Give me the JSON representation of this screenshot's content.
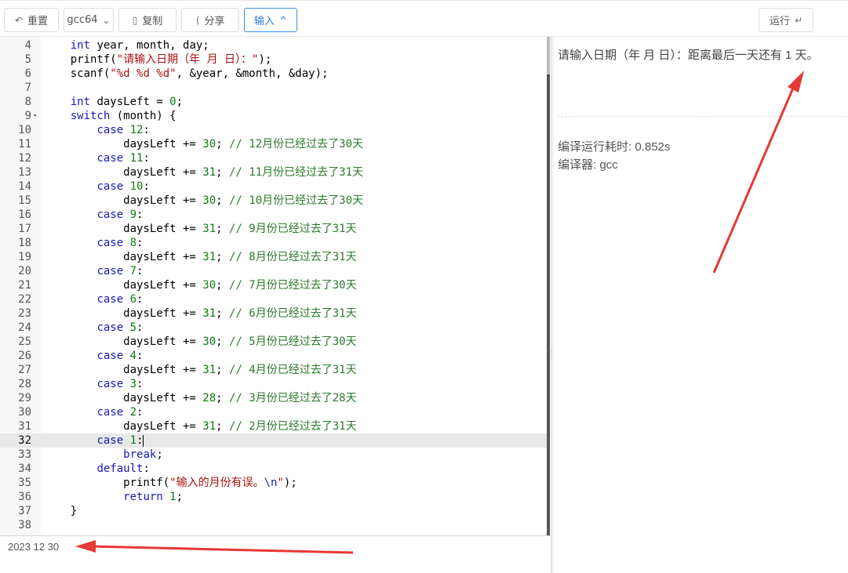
{
  "toolbar": {
    "reset_icon": "undo-icon",
    "reset_label": "重置",
    "compiler_label": "gcc64",
    "compiler_arrow": "⌄",
    "copy_icon": "copy-icon",
    "copy_label": "复制",
    "share_icon": "share-icon",
    "share_label": "分享",
    "input_label": "输入",
    "input_arrow": "^",
    "run_label": "运行",
    "run_icon": "↵"
  },
  "editor": {
    "active_line": 32,
    "lines": [
      {
        "n": "4",
        "tokens": [
          [
            "",
            "    "
          ],
          [
            "kw",
            "int"
          ],
          [
            "",
            " year, month, day;"
          ]
        ]
      },
      {
        "n": "5",
        "tokens": [
          [
            "",
            "    printf("
          ],
          [
            "str",
            "\"请输入日期（年 月 日）：\""
          ],
          [
            "",
            ");"
          ]
        ]
      },
      {
        "n": "6",
        "tokens": [
          [
            "",
            "    scanf("
          ],
          [
            "str",
            "\"%d %d %d\""
          ],
          [
            "",
            ", &year, &month, &day);"
          ]
        ]
      },
      {
        "n": "7",
        "tokens": []
      },
      {
        "n": "8",
        "tokens": [
          [
            "",
            "    "
          ],
          [
            "kw",
            "int"
          ],
          [
            "",
            " daysLeft = "
          ],
          [
            "num",
            "0"
          ],
          [
            "",
            ";"
          ]
        ]
      },
      {
        "n": "9",
        "fold": true,
        "tokens": [
          [
            "",
            "    "
          ],
          [
            "kw",
            "switch"
          ],
          [
            "",
            " (month) {"
          ]
        ]
      },
      {
        "n": "10",
        "tokens": [
          [
            "",
            "        "
          ],
          [
            "kw",
            "case"
          ],
          [
            "",
            " "
          ],
          [
            "num",
            "12"
          ],
          [
            "",
            ":"
          ]
        ]
      },
      {
        "n": "11",
        "tokens": [
          [
            "",
            "            daysLeft += "
          ],
          [
            "num",
            "30"
          ],
          [
            "",
            "; "
          ],
          [
            "cmt",
            "// 12月份已经过去了30天"
          ]
        ]
      },
      {
        "n": "12",
        "tokens": [
          [
            "",
            "        "
          ],
          [
            "kw",
            "case"
          ],
          [
            "",
            " "
          ],
          [
            "num",
            "11"
          ],
          [
            "",
            ":"
          ]
        ]
      },
      {
        "n": "13",
        "tokens": [
          [
            "",
            "            daysLeft += "
          ],
          [
            "num",
            "31"
          ],
          [
            "",
            "; "
          ],
          [
            "cmt",
            "// 11月份已经过去了31天"
          ]
        ]
      },
      {
        "n": "14",
        "tokens": [
          [
            "",
            "        "
          ],
          [
            "kw",
            "case"
          ],
          [
            "",
            " "
          ],
          [
            "num",
            "10"
          ],
          [
            "",
            ":"
          ]
        ]
      },
      {
        "n": "15",
        "tokens": [
          [
            "",
            "            daysLeft += "
          ],
          [
            "num",
            "30"
          ],
          [
            "",
            "; "
          ],
          [
            "cmt",
            "// 10月份已经过去了30天"
          ]
        ]
      },
      {
        "n": "16",
        "tokens": [
          [
            "",
            "        "
          ],
          [
            "kw",
            "case"
          ],
          [
            "",
            " "
          ],
          [
            "num",
            "9"
          ],
          [
            "",
            ":"
          ]
        ]
      },
      {
        "n": "17",
        "tokens": [
          [
            "",
            "            daysLeft += "
          ],
          [
            "num",
            "31"
          ],
          [
            "",
            "; "
          ],
          [
            "cmt",
            "// 9月份已经过去了31天"
          ]
        ]
      },
      {
        "n": "18",
        "tokens": [
          [
            "",
            "        "
          ],
          [
            "kw",
            "case"
          ],
          [
            "",
            " "
          ],
          [
            "num",
            "8"
          ],
          [
            "",
            ":"
          ]
        ]
      },
      {
        "n": "19",
        "tokens": [
          [
            "",
            "            daysLeft += "
          ],
          [
            "num",
            "31"
          ],
          [
            "",
            "; "
          ],
          [
            "cmt",
            "// 8月份已经过去了31天"
          ]
        ]
      },
      {
        "n": "20",
        "tokens": [
          [
            "",
            "        "
          ],
          [
            "kw",
            "case"
          ],
          [
            "",
            " "
          ],
          [
            "num",
            "7"
          ],
          [
            "",
            ":"
          ]
        ]
      },
      {
        "n": "21",
        "tokens": [
          [
            "",
            "            daysLeft += "
          ],
          [
            "num",
            "30"
          ],
          [
            "",
            "; "
          ],
          [
            "cmt",
            "// 7月份已经过去了30天"
          ]
        ]
      },
      {
        "n": "22",
        "tokens": [
          [
            "",
            "        "
          ],
          [
            "kw",
            "case"
          ],
          [
            "",
            " "
          ],
          [
            "num",
            "6"
          ],
          [
            "",
            ":"
          ]
        ]
      },
      {
        "n": "23",
        "tokens": [
          [
            "",
            "            daysLeft += "
          ],
          [
            "num",
            "31"
          ],
          [
            "",
            "; "
          ],
          [
            "cmt",
            "// 6月份已经过去了31天"
          ]
        ]
      },
      {
        "n": "24",
        "tokens": [
          [
            "",
            "        "
          ],
          [
            "kw",
            "case"
          ],
          [
            "",
            " "
          ],
          [
            "num",
            "5"
          ],
          [
            "",
            ":"
          ]
        ]
      },
      {
        "n": "25",
        "tokens": [
          [
            "",
            "            daysLeft += "
          ],
          [
            "num",
            "30"
          ],
          [
            "",
            "; "
          ],
          [
            "cmt",
            "// 5月份已经过去了30天"
          ]
        ]
      },
      {
        "n": "26",
        "tokens": [
          [
            "",
            "        "
          ],
          [
            "kw",
            "case"
          ],
          [
            "",
            " "
          ],
          [
            "num",
            "4"
          ],
          [
            "",
            ":"
          ]
        ]
      },
      {
        "n": "27",
        "tokens": [
          [
            "",
            "            daysLeft += "
          ],
          [
            "num",
            "31"
          ],
          [
            "",
            "; "
          ],
          [
            "cmt",
            "// 4月份已经过去了31天"
          ]
        ]
      },
      {
        "n": "28",
        "tokens": [
          [
            "",
            "        "
          ],
          [
            "kw",
            "case"
          ],
          [
            "",
            " "
          ],
          [
            "num",
            "3"
          ],
          [
            "",
            ":"
          ]
        ]
      },
      {
        "n": "29",
        "tokens": [
          [
            "",
            "            daysLeft += "
          ],
          [
            "num",
            "28"
          ],
          [
            "",
            "; "
          ],
          [
            "cmt",
            "// 3月份已经过去了28天"
          ]
        ]
      },
      {
        "n": "30",
        "tokens": [
          [
            "",
            "        "
          ],
          [
            "kw",
            "case"
          ],
          [
            "",
            " "
          ],
          [
            "num",
            "2"
          ],
          [
            "",
            ":"
          ]
        ]
      },
      {
        "n": "31",
        "tokens": [
          [
            "",
            "            daysLeft += "
          ],
          [
            "num",
            "31"
          ],
          [
            "",
            "; "
          ],
          [
            "cmt",
            "// 2月份已经过去了31天"
          ]
        ]
      },
      {
        "n": "32",
        "tokens": [
          [
            "",
            "        "
          ],
          [
            "kw",
            "case"
          ],
          [
            "",
            " "
          ],
          [
            "num",
            "1"
          ],
          [
            "",
            ":"
          ]
        ],
        "cursor": true
      },
      {
        "n": "33",
        "tokens": [
          [
            "",
            "            "
          ],
          [
            "kw",
            "break"
          ],
          [
            "",
            ";"
          ]
        ]
      },
      {
        "n": "34",
        "tokens": [
          [
            "",
            "        "
          ],
          [
            "kw",
            "default"
          ],
          [
            "",
            ":"
          ]
        ]
      },
      {
        "n": "35",
        "tokens": [
          [
            "",
            "            printf("
          ],
          [
            "str",
            "\"输入的月份有误。"
          ],
          [
            "kw",
            "\\n"
          ],
          [
            "str",
            "\""
          ],
          [
            "",
            ");"
          ]
        ]
      },
      {
        "n": "36",
        "tokens": [
          [
            "",
            "            "
          ],
          [
            "kw",
            "return"
          ],
          [
            "",
            " "
          ],
          [
            "num",
            "1"
          ],
          [
            "",
            ";"
          ]
        ]
      },
      {
        "n": "37",
        "tokens": [
          [
            "",
            "    }"
          ]
        ]
      },
      {
        "n": "38",
        "tokens": []
      }
    ]
  },
  "stdin": {
    "value": "2023 12 30"
  },
  "output": {
    "result": "请输入日期（年 月 日）：距离最后一天还有 1 天。",
    "compile_time": "编译运行耗时: 0.852s",
    "compiler": "编译器: gcc"
  },
  "colors": {
    "accent": "#3a8ee6",
    "annotation_arrow": "#e53935"
  }
}
